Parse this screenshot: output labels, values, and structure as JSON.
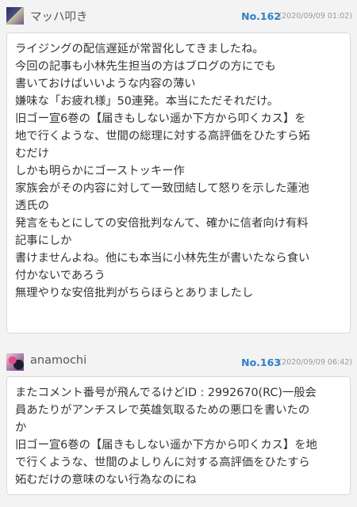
{
  "comments": [
    {
      "username": "マッハ叩き",
      "number": "No.162",
      "date": "(2020/09/09 01:02)",
      "avatar": "user-avatar-image",
      "body": "ライジングの配信遅延が常習化してきましたね。\n今回の記事も小林先生担当の方はブログの方にでも\n書いておけばいいような内容の薄い\n嫌味な「お疲れ様」50連発。本当にただそれだけ。\n旧ゴー宣6巻の【届きもしない遥か下方から叩くカス】を\n地で行くような、世間の総理に対する高評価をひたすら妬\nむだけ\nしかも明らかにゴーストッキー作\n家族会がその内容に対して一致団結して怒りを示した蓮池\n透氏の\n発言をもとにしての安倍批判なんて、確かに信者向け有料\n記事にしか\n書けませんよね。他にも本当に小林先生が書いたなら食い\n付かないであろう\n無理やりな安倍批判がちらほらとありましたし"
    },
    {
      "username": "anamochi",
      "number": "No.163",
      "date": "(2020/09/09 06:42)",
      "avatar": "user-avatar-image",
      "body": "またコメント番号が飛んでるけどID : 2992670(RC)一般会\n員あたりがアンチスレで英雄気取るための悪口を書いたの\nか\n旧ゴー宣6巻の【届きもしない遥か下方から叩くカス】を地\nで行くような、世間のよしりんに対する高評価をひたすら\n妬むだけの意味のない行為なのにね"
    }
  ],
  "colors": {
    "number": "#2f7fc8",
    "date": "#999999",
    "background": "#f3f3f3",
    "bubble": "#ffffff"
  }
}
